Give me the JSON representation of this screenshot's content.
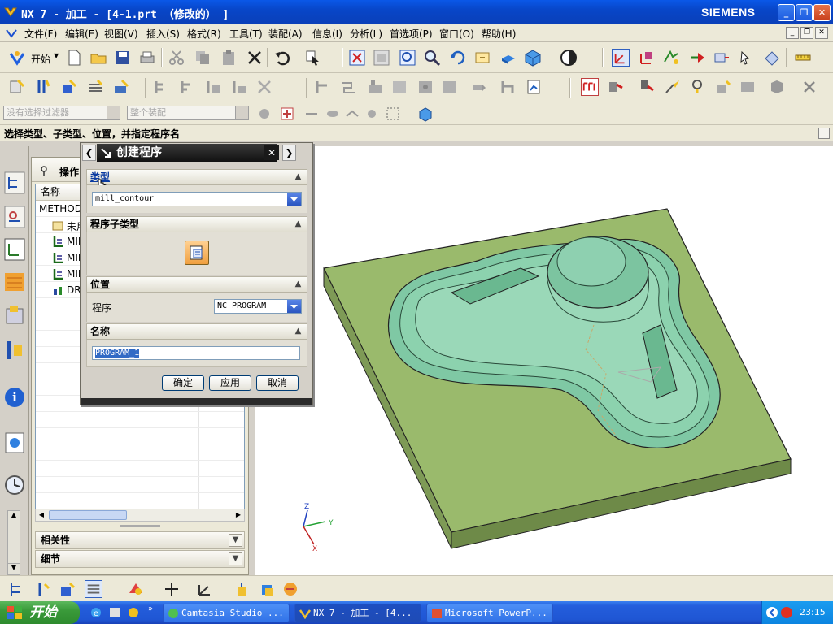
{
  "window": {
    "title": "NX 7 - 加工 - [4-1.prt （修改的） ]",
    "brand": "SIEMENS"
  },
  "menubar": {
    "items": [
      "文件(F)",
      "编辑(E)",
      "视图(V)",
      "插入(S)",
      "格式(R)",
      "工具(T)",
      "装配(A)",
      "信息(I)",
      "分析(L)",
      "首选项(P)",
      "窗口(O)",
      "帮助(H)"
    ]
  },
  "toolbar": {
    "start_label": "开始"
  },
  "filter": {
    "selection_filter": "没有选择过滤器",
    "scope": "整个装配"
  },
  "cue_line": "选择类型、子类型、位置，并指定程序名",
  "navigator": {
    "title": "操作",
    "columns": [
      "名称"
    ],
    "rows": [
      {
        "label": "METHOD",
        "indent": 0
      },
      {
        "label": "未用",
        "indent": 1
      },
      {
        "label": "MIL",
        "indent": 1
      },
      {
        "label": "MIL",
        "indent": 1
      },
      {
        "label": "MIL",
        "indent": 1
      },
      {
        "label": "DR",
        "indent": 1
      }
    ],
    "panels": [
      "相关性",
      "细节"
    ]
  },
  "dialog": {
    "title": "创建程序",
    "sections": {
      "type": "类型",
      "subtype": "程序子类型",
      "location": "位置",
      "name": "名称"
    },
    "type_value": "mill_contour",
    "program_label": "程序",
    "program_value": "NC_PROGRAM",
    "name_value": "PROGRAM_1",
    "buttons": {
      "ok": "确定",
      "apply": "应用",
      "cancel": "取消"
    }
  },
  "viewport": {
    "triad": {
      "z": "Z",
      "y": "Y",
      "x": "X"
    },
    "part_color": "#9aba6c",
    "cavity_color": "#7fc8a4"
  },
  "taskbar": {
    "start": "开始",
    "tasks": [
      "Camtasia Studio ...",
      "NX 7 - 加工 - [4...",
      "Microsoft PowerP..."
    ],
    "clock": "23:15"
  }
}
